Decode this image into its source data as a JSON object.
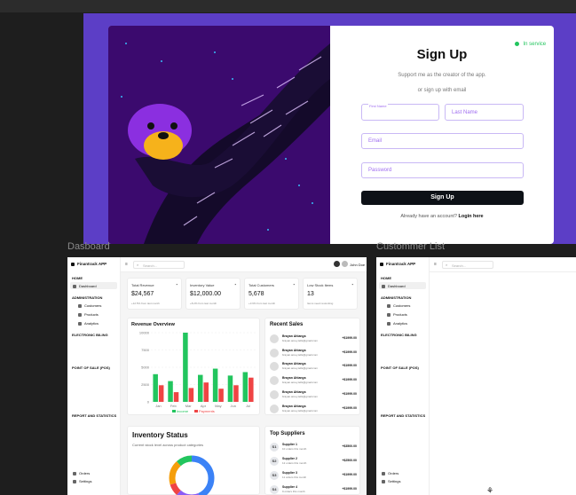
{
  "signup": {
    "status": "In service",
    "status_color": "#22c55e",
    "title": "Sign Up",
    "subtitle": "Support me as the creator of the app.",
    "or_text": "or sign up with email",
    "first_name_label": "First Name",
    "last_name_placeholder": "Last Name",
    "email_placeholder": "Email",
    "password_placeholder": "Password",
    "button": "Sign Up",
    "have_account": "Already have an account?",
    "login": "Login here"
  },
  "frames": {
    "dashboard": "Dasboard",
    "customer_list": "Custommer List"
  },
  "app": {
    "name": "Finantrack APP",
    "search": "Search...",
    "user": "John Doe",
    "sidebar": {
      "home": "HOME",
      "dashboard": "Dashboard",
      "administration": "ADMINISTRATION",
      "customers": "Customers",
      "products": "Products",
      "analytics": "Analytics",
      "billing": "ELECTRONIC BILING",
      "pos": "POINT OF SALE (POS)",
      "reports": "REPORT AND STATISTICS",
      "orders": "Orders",
      "settings": "Settings"
    }
  },
  "stats": [
    {
      "label": "Total Revenue",
      "value": "$24,567",
      "note": "+12.5% from last month"
    },
    {
      "label": "Inventory Value",
      "value": "$12,000.00",
      "note": "+8.2% from last month"
    },
    {
      "label": "Total Customers",
      "value": "5,678",
      "note": "+3.6% from last month"
    },
    {
      "label": "Low Stock Items",
      "value": "13",
      "note": "Items need restocking"
    }
  ],
  "revenue": {
    "title": "Revenue Overview",
    "legend_income": "Income",
    "legend_payments": "Payments"
  },
  "chart_data": {
    "type": "bar",
    "categories": [
      "Jan",
      "Feb",
      "Mar",
      "Apr",
      "May",
      "Jun",
      "Jul"
    ],
    "series": [
      {
        "name": "Income",
        "values": [
          4000,
          3000,
          10000,
          3900,
          4800,
          3800,
          4300
        ]
      },
      {
        "name": "Payments",
        "values": [
          2400,
          1400,
          2000,
          2800,
          1900,
          2400,
          3500
        ]
      }
    ],
    "yticks": [
      "10000",
      "7500",
      "5000",
      "2500",
      "0"
    ],
    "ylim": [
      0,
      10000
    ],
    "colors": {
      "Income": "#22c55e",
      "Payments": "#ef4444"
    }
  },
  "recent_sales": {
    "title": "Recent Sales",
    "items": [
      {
        "name": "Brayan Ahlanga",
        "email": "brayan.amey.tells@gmail.com",
        "amount": "+$1999.00"
      },
      {
        "name": "Brayan Ahlanga",
        "email": "brayan.amey.tells@gmail.com",
        "amount": "+$1999.00"
      },
      {
        "name": "Brayan Ahlanga",
        "email": "brayan.amey.tells@gmail.com",
        "amount": "+$1999.00"
      },
      {
        "name": "Brayan Ahlanga",
        "email": "brayan.amey.tells@gmail.com",
        "amount": "+$1999.00"
      },
      {
        "name": "Brayan Ahlanga",
        "email": "brayan.amey.tells@gmail.com",
        "amount": "+$1999.00"
      },
      {
        "name": "Brayan Ahlanga",
        "email": "brayan.amey.tells@gmail.com",
        "amount": "+$1999.00"
      }
    ]
  },
  "inventory": {
    "title": "Inventory Status",
    "subtitle": "Current stock level across product categories"
  },
  "suppliers": {
    "title": "Top Suppliers",
    "items": [
      {
        "badge": "S1",
        "name": "Supplier 1",
        "desc": "10 orders this month",
        "amount": "+$3500.00"
      },
      {
        "badge": "S2",
        "name": "Supplier 2",
        "desc": "12 orders this month",
        "amount": "+$2500.00"
      },
      {
        "badge": "S3",
        "name": "Supplier 3",
        "desc": "11 orders this month",
        "amount": "+$1999.00"
      },
      {
        "badge": "S4",
        "name": "Supplier 4",
        "desc": "9 orders this month",
        "amount": "+$1999.00"
      }
    ]
  }
}
